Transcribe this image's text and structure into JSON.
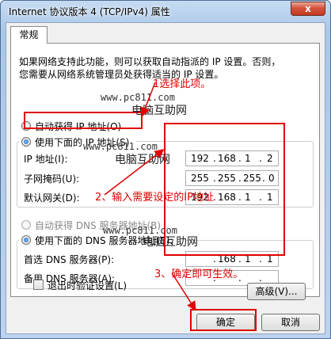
{
  "window": {
    "title": "Internet 协议版本 4 (TCP/IPv4) 属性",
    "close_label": "x"
  },
  "tabs": [
    {
      "label": "常规"
    }
  ],
  "description": {
    "line1": "如果网络支持此功能，则可以获取自动指派的 IP 设置。否则，",
    "line2": "您需要从网络系统管理员处获得适当的 IP 设置。"
  },
  "ip_section": {
    "auto_label": "自动获得 IP 地址(O)",
    "manual_label": "使用下面的 IP 地址(S)",
    "manual_selected": true,
    "fields": [
      {
        "label": "IP 地址(I):",
        "octets": [
          "192",
          "168",
          "1",
          "2"
        ]
      },
      {
        "label": "子网掩码(U):",
        "octets": [
          "255",
          "255",
          "255",
          "0"
        ]
      },
      {
        "label": "默认网关(D):",
        "octets": [
          "192",
          "168",
          "1",
          "1"
        ]
      }
    ]
  },
  "dns_section": {
    "auto_label": "自动获得 DNS 服务器地址(B)",
    "manual_label": "使用下面的 DNS 服务器地址(E):",
    "manual_selected": true,
    "fields": [
      {
        "label": "首选 DNS 服务器(P):",
        "octets": [
          "",
          "168",
          "1",
          "1"
        ]
      },
      {
        "label": "备用 DNS 服务器(A):",
        "octets": [
          "",
          "",
          "",
          ""
        ]
      }
    ]
  },
  "validate_on_exit": {
    "label": "退出时验证设置(L)",
    "checked": false
  },
  "buttons": {
    "advanced": "高级(V)...",
    "ok": "确定",
    "cancel": "取消"
  },
  "annotations": {
    "step1": "1选择此项。",
    "step2": "2、输入需要设定的IP地址",
    "step3": "3、确定即可生效。"
  },
  "watermarks": {
    "site": "www.pc811.com",
    "name": "电脑互助网"
  },
  "colors": {
    "annotation_red": "#e00000",
    "title_bar": "#aac6e8",
    "close_button": "#c23a22"
  }
}
